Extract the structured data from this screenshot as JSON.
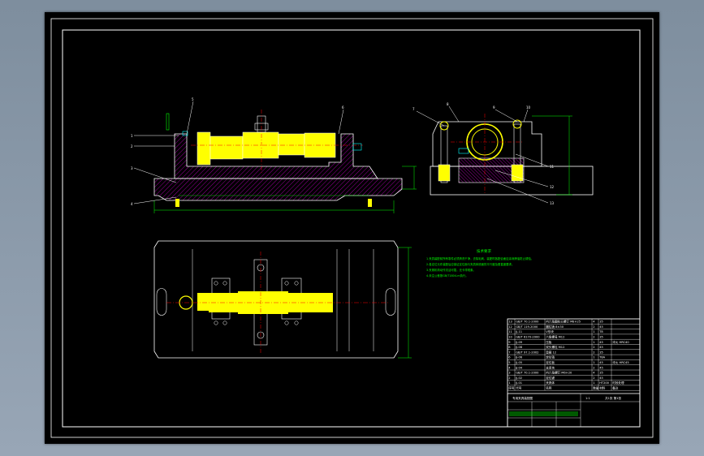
{
  "drawing": {
    "tech_notes": {
      "title": "技术要求",
      "lines": [
        "1.夹具装配前所有零件必须清洗干净，去除毛刺，装配时各配合面应涂润滑油防止锈蚀。",
        "2.各定位元件装配后应保证定位面与夹具体底面的平行度及垂直度要求。",
        "3.夹紧机构动作灵活可靠，无卡滞现象。",
        "4.未注公差按GB/T1804-m执行。"
      ]
    },
    "part_labels": [
      "1",
      "2",
      "3",
      "4",
      "5",
      "6",
      "7",
      "8",
      "9",
      "10",
      "11",
      "12",
      "13"
    ],
    "bom_rows": [
      [
        "13",
        "GB/T 70.1-2000",
        "内六角圆柱头螺钉 M8×25",
        "4",
        "35",
        ""
      ],
      [
        "12",
        "GB/T 119-2000",
        "圆柱销 8×30",
        "2",
        "45",
        ""
      ],
      [
        "11",
        "JJ-11",
        "V形块",
        "1",
        "T8",
        ""
      ],
      [
        "10",
        "GB/T 6170-2000",
        "六角螺母 M12",
        "2",
        "35",
        ""
      ],
      [
        "9",
        "JJ-09",
        "压板",
        "1",
        "45",
        "淬火 HRC40"
      ],
      [
        "8",
        "JJ-08",
        "双头螺柱 M12",
        "2",
        "45",
        ""
      ],
      [
        "7",
        "GB/T 97.1-2002",
        "垫圈 12",
        "2",
        "35",
        ""
      ],
      [
        "6",
        "JJ-06",
        "定位销",
        "1",
        "T8A",
        ""
      ],
      [
        "5",
        "JJ-05",
        "定位板",
        "1",
        "45",
        "淬火 HRC45"
      ],
      [
        "4",
        "JJ-04",
        "支承块",
        "2",
        "45",
        ""
      ],
      [
        "3",
        "GB/T 70.1-2000",
        "内六角螺钉 M6×20",
        "4",
        "35",
        ""
      ],
      [
        "2",
        "JJ-02",
        "定位键",
        "2",
        "45",
        ""
      ],
      [
        "1",
        "JJ-01",
        "夹具体",
        "1",
        "HT200",
        "时效处理"
      ]
    ],
    "bom_header": [
      "序号",
      "代号",
      "名称",
      "数量",
      "材料",
      "备注"
    ],
    "title_block": {
      "name": "专用夹具装配图",
      "scale": "1:1",
      "sheet": "共1张 第1张"
    }
  }
}
